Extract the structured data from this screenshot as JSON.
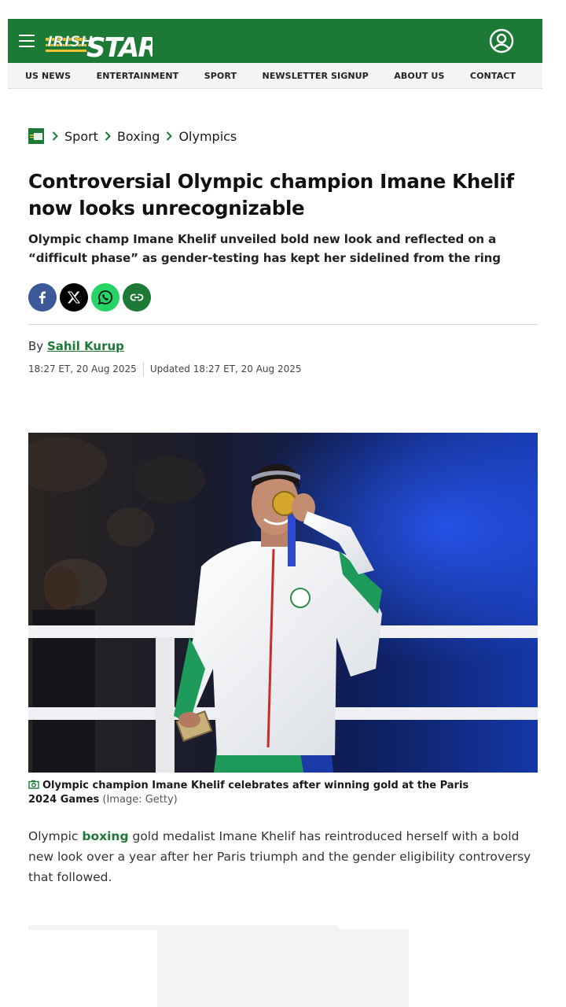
{
  "header": {
    "logo_text_top": "IRISH",
    "logo_text_main": "STAR",
    "menu_icon": "hamburger-menu-icon",
    "account_icon": "user-account-icon",
    "colors": {
      "brand_green": "#1c7a36",
      "accent_gold": "#f2c230"
    }
  },
  "nav": {
    "items": [
      {
        "label": "US NEWS"
      },
      {
        "label": "ENTERTAINMENT"
      },
      {
        "label": "SPORT"
      },
      {
        "label": "NEWSLETTER SIGNUP"
      },
      {
        "label": "ABOUT US"
      },
      {
        "label": "CONTACT"
      }
    ]
  },
  "breadcrumb": {
    "items": [
      {
        "label": "Sport"
      },
      {
        "label": "Boxing"
      },
      {
        "label": "Olympics"
      }
    ]
  },
  "article": {
    "title": "Controversial Olympic champion Imane Khelif now looks unrecognizable",
    "subtitle": "Olympic champ Imane Khelif unveiled bold new look and reflected on a “difficult phase” as gender-testing has kept her sidelined from the ring",
    "byline_prefix": "By",
    "author": "Sahil Kurup",
    "published": "18:27 ET, 20 Aug 2025",
    "updated": "Updated 18:27 ET, 20 Aug 2025",
    "share": [
      "facebook-icon",
      "x-icon",
      "whatsapp-icon",
      "copy-link-icon"
    ],
    "image_caption": "Olympic champion Imane Khelif celebrates after winning gold at the Paris 2024 Games",
    "image_credit": "(Image: Getty)",
    "body_before_link": "Olympic ",
    "body_link": "boxing",
    "body_after_link": " gold medalist Imane Khelif has reintroduced herself with a bold new look over a year after her Paris triumph and the gender eligibility controversy that followed."
  }
}
